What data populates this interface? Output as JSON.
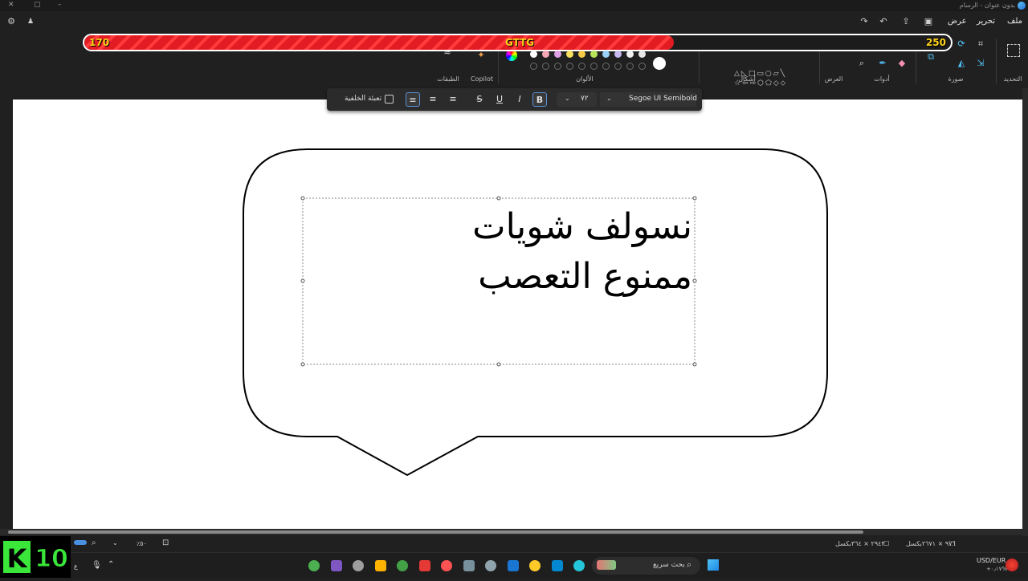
{
  "titlebar": {
    "title": "بدون عنوان - الرسام"
  },
  "menu": {
    "file": "ملف",
    "edit": "تحرير",
    "view": "عرض"
  },
  "ribbon": {
    "groups": {
      "select": "التحديد",
      "image": "صورة",
      "tools": "أدوات",
      "brushes": "العرض",
      "shapes": "أشكال",
      "colors": "الألوان",
      "copilot": "Copilot",
      "layers": "الطبقات"
    },
    "colors_filled": [
      "#ffffff",
      "#f4a6b5",
      "#e0a0e6",
      "#f6e05e",
      "#f7c948",
      "#b7e35a",
      "#9ad0f5",
      "#c7b8f0",
      "#f0f0f0",
      "#e8e8e8"
    ]
  },
  "overlay_bar": {
    "left_value": "170",
    "center_label": "GTTG",
    "right_value": "250",
    "progress": 0.68,
    "fill_color": "#e31b23",
    "label_color": "#ffd21a"
  },
  "format_toolbar": {
    "fill_background": "تعبئة الخلفية",
    "font_name": "Segoe UI Semibold",
    "font_size": "٧٢",
    "bold": "B",
    "italic": "I",
    "underline": "U",
    "strike": "S"
  },
  "canvas": {
    "text_lines": [
      "نسولف شويات",
      "ممنوع التعصب"
    ]
  },
  "statusbar": {
    "canvas_size": "٩٧٦ × ٢٦٧١بكسل",
    "selection_size": "٢٩٤٣ × ٣٦٤بكسل",
    "zoom": "٪٥٠"
  },
  "taskbar": {
    "search_placeholder": "بحث سريع",
    "currency_pair": "USD/EUR",
    "currency_change": "+٠٫١٧%",
    "language": "ع"
  },
  "logo": {
    "letter": "K",
    "number": "10"
  }
}
